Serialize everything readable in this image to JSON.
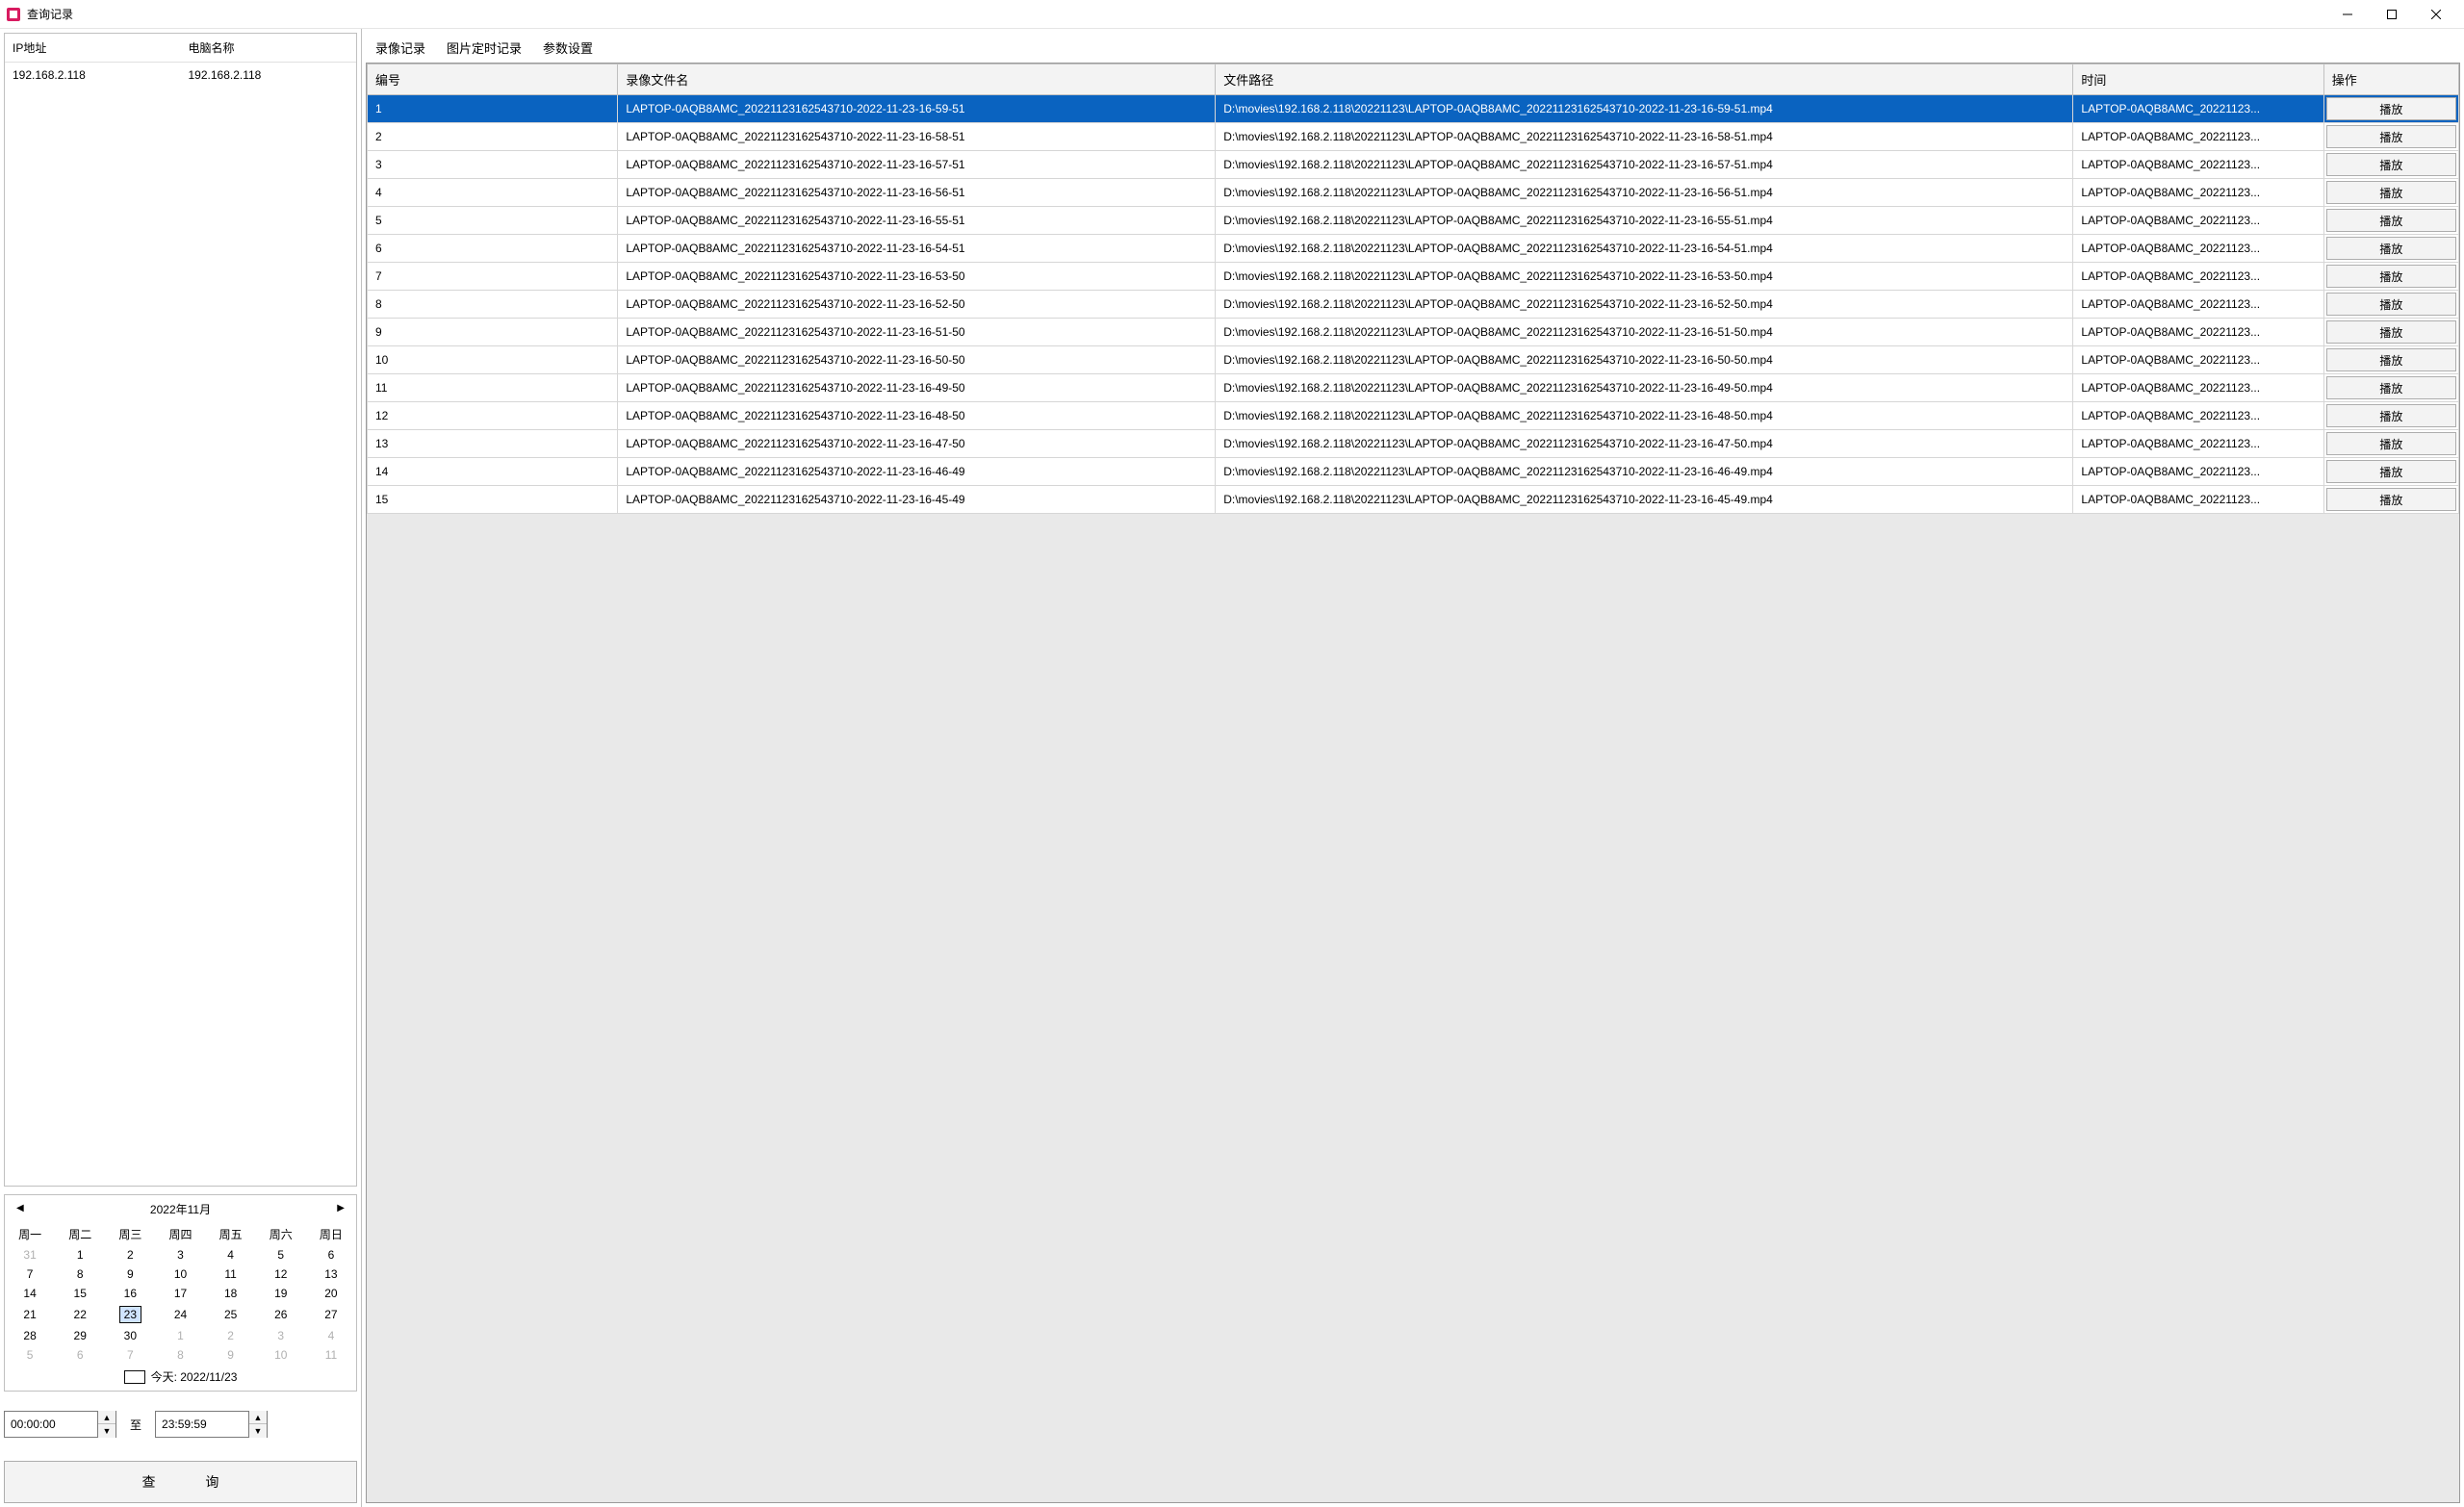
{
  "window": {
    "title": "查询记录"
  },
  "sidebar": {
    "headers": {
      "ip": "IP地址",
      "pc": "电脑名称"
    },
    "rows": [
      {
        "ip": "192.168.2.118",
        "pc": "192.168.2.118"
      }
    ]
  },
  "calendar": {
    "title": "2022年11月",
    "weekdays": [
      "周一",
      "周二",
      "周三",
      "周四",
      "周五",
      "周六",
      "周日"
    ],
    "today_label": "今天: 2022/11/23",
    "selected_day": 23,
    "weeks": [
      [
        {
          "d": 31,
          "o": true
        },
        {
          "d": 1
        },
        {
          "d": 2
        },
        {
          "d": 3
        },
        {
          "d": 4
        },
        {
          "d": 5
        },
        {
          "d": 6
        }
      ],
      [
        {
          "d": 7
        },
        {
          "d": 8
        },
        {
          "d": 9
        },
        {
          "d": 10
        },
        {
          "d": 11
        },
        {
          "d": 12
        },
        {
          "d": 13
        }
      ],
      [
        {
          "d": 14
        },
        {
          "d": 15
        },
        {
          "d": 16
        },
        {
          "d": 17
        },
        {
          "d": 18
        },
        {
          "d": 19
        },
        {
          "d": 20
        }
      ],
      [
        {
          "d": 21
        },
        {
          "d": 22
        },
        {
          "d": 23,
          "sel": true
        },
        {
          "d": 24
        },
        {
          "d": 25
        },
        {
          "d": 26
        },
        {
          "d": 27
        }
      ],
      [
        {
          "d": 28
        },
        {
          "d": 29
        },
        {
          "d": 30
        },
        {
          "d": 1,
          "o": true
        },
        {
          "d": 2,
          "o": true
        },
        {
          "d": 3,
          "o": true
        },
        {
          "d": 4,
          "o": true
        }
      ],
      [
        {
          "d": 5,
          "o": true
        },
        {
          "d": 6,
          "o": true
        },
        {
          "d": 7,
          "o": true
        },
        {
          "d": 8,
          "o": true
        },
        {
          "d": 9,
          "o": true
        },
        {
          "d": 10,
          "o": true
        },
        {
          "d": 11,
          "o": true
        }
      ]
    ]
  },
  "time_range": {
    "from": "00:00:00",
    "to_label": "至",
    "to": "23:59:59"
  },
  "query_button": "查     询",
  "tabs": {
    "items": [
      {
        "label": "录像记录",
        "active": true
      },
      {
        "label": "图片定时记录"
      },
      {
        "label": "参数设置"
      }
    ]
  },
  "grid": {
    "headers": {
      "idx": "编号",
      "name": "录像文件名",
      "path": "文件路径",
      "time": "时间",
      "op": "操作"
    },
    "op_label": "播放",
    "rows": [
      {
        "idx": 1,
        "name": "LAPTOP-0AQB8AMC_20221123162543710-2022-11-23-16-59-51",
        "path": "D:\\movies\\192.168.2.118\\20221123\\LAPTOP-0AQB8AMC_20221123162543710-2022-11-23-16-59-51.mp4",
        "time": "LAPTOP-0AQB8AMC_20221123..."
      },
      {
        "idx": 2,
        "name": "LAPTOP-0AQB8AMC_20221123162543710-2022-11-23-16-58-51",
        "path": "D:\\movies\\192.168.2.118\\20221123\\LAPTOP-0AQB8AMC_20221123162543710-2022-11-23-16-58-51.mp4",
        "time": "LAPTOP-0AQB8AMC_20221123..."
      },
      {
        "idx": 3,
        "name": "LAPTOP-0AQB8AMC_20221123162543710-2022-11-23-16-57-51",
        "path": "D:\\movies\\192.168.2.118\\20221123\\LAPTOP-0AQB8AMC_20221123162543710-2022-11-23-16-57-51.mp4",
        "time": "LAPTOP-0AQB8AMC_20221123..."
      },
      {
        "idx": 4,
        "name": "LAPTOP-0AQB8AMC_20221123162543710-2022-11-23-16-56-51",
        "path": "D:\\movies\\192.168.2.118\\20221123\\LAPTOP-0AQB8AMC_20221123162543710-2022-11-23-16-56-51.mp4",
        "time": "LAPTOP-0AQB8AMC_20221123..."
      },
      {
        "idx": 5,
        "name": "LAPTOP-0AQB8AMC_20221123162543710-2022-11-23-16-55-51",
        "path": "D:\\movies\\192.168.2.118\\20221123\\LAPTOP-0AQB8AMC_20221123162543710-2022-11-23-16-55-51.mp4",
        "time": "LAPTOP-0AQB8AMC_20221123..."
      },
      {
        "idx": 6,
        "name": "LAPTOP-0AQB8AMC_20221123162543710-2022-11-23-16-54-51",
        "path": "D:\\movies\\192.168.2.118\\20221123\\LAPTOP-0AQB8AMC_20221123162543710-2022-11-23-16-54-51.mp4",
        "time": "LAPTOP-0AQB8AMC_20221123..."
      },
      {
        "idx": 7,
        "name": "LAPTOP-0AQB8AMC_20221123162543710-2022-11-23-16-53-50",
        "path": "D:\\movies\\192.168.2.118\\20221123\\LAPTOP-0AQB8AMC_20221123162543710-2022-11-23-16-53-50.mp4",
        "time": "LAPTOP-0AQB8AMC_20221123..."
      },
      {
        "idx": 8,
        "name": "LAPTOP-0AQB8AMC_20221123162543710-2022-11-23-16-52-50",
        "path": "D:\\movies\\192.168.2.118\\20221123\\LAPTOP-0AQB8AMC_20221123162543710-2022-11-23-16-52-50.mp4",
        "time": "LAPTOP-0AQB8AMC_20221123..."
      },
      {
        "idx": 9,
        "name": "LAPTOP-0AQB8AMC_20221123162543710-2022-11-23-16-51-50",
        "path": "D:\\movies\\192.168.2.118\\20221123\\LAPTOP-0AQB8AMC_20221123162543710-2022-11-23-16-51-50.mp4",
        "time": "LAPTOP-0AQB8AMC_20221123..."
      },
      {
        "idx": 10,
        "name": "LAPTOP-0AQB8AMC_20221123162543710-2022-11-23-16-50-50",
        "path": "D:\\movies\\192.168.2.118\\20221123\\LAPTOP-0AQB8AMC_20221123162543710-2022-11-23-16-50-50.mp4",
        "time": "LAPTOP-0AQB8AMC_20221123..."
      },
      {
        "idx": 11,
        "name": "LAPTOP-0AQB8AMC_20221123162543710-2022-11-23-16-49-50",
        "path": "D:\\movies\\192.168.2.118\\20221123\\LAPTOP-0AQB8AMC_20221123162543710-2022-11-23-16-49-50.mp4",
        "time": "LAPTOP-0AQB8AMC_20221123..."
      },
      {
        "idx": 12,
        "name": "LAPTOP-0AQB8AMC_20221123162543710-2022-11-23-16-48-50",
        "path": "D:\\movies\\192.168.2.118\\20221123\\LAPTOP-0AQB8AMC_20221123162543710-2022-11-23-16-48-50.mp4",
        "time": "LAPTOP-0AQB8AMC_20221123..."
      },
      {
        "idx": 13,
        "name": "LAPTOP-0AQB8AMC_20221123162543710-2022-11-23-16-47-50",
        "path": "D:\\movies\\192.168.2.118\\20221123\\LAPTOP-0AQB8AMC_20221123162543710-2022-11-23-16-47-50.mp4",
        "time": "LAPTOP-0AQB8AMC_20221123..."
      },
      {
        "idx": 14,
        "name": "LAPTOP-0AQB8AMC_20221123162543710-2022-11-23-16-46-49",
        "path": "D:\\movies\\192.168.2.118\\20221123\\LAPTOP-0AQB8AMC_20221123162543710-2022-11-23-16-46-49.mp4",
        "time": "LAPTOP-0AQB8AMC_20221123..."
      },
      {
        "idx": 15,
        "name": "LAPTOP-0AQB8AMC_20221123162543710-2022-11-23-16-45-49",
        "path": "D:\\movies\\192.168.2.118\\20221123\\LAPTOP-0AQB8AMC_20221123162543710-2022-11-23-16-45-49.mp4",
        "time": "LAPTOP-0AQB8AMC_20221123..."
      }
    ],
    "selected_index": 0
  }
}
